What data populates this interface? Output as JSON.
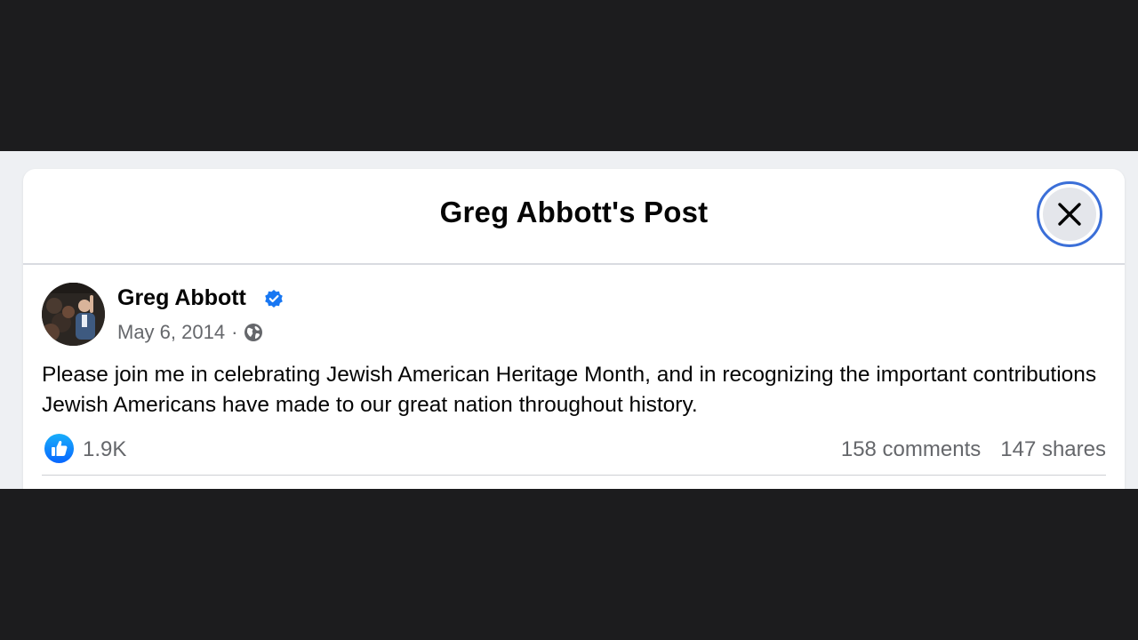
{
  "dialog": {
    "title": "Greg Abbott's Post",
    "close_icon": "close-icon"
  },
  "post": {
    "author": "Greg Abbott",
    "verified_icon": "verified-badge-icon",
    "date": "May 6, 2014",
    "separator": "·",
    "audience_icon": "globe-icon",
    "text": "Please join me in celebrating Jewish American Heritage Month, and in recognizing the important contributions Jewish Americans have made to our great nation throughout history.",
    "stats": {
      "reaction_icon": "like-icon",
      "reactions": "1.9K",
      "comments": "158 comments",
      "shares": "147 shares"
    }
  },
  "colors": {
    "brand_blue": "#1877f2",
    "focus_ring": "#3b6fd8",
    "secondary_text": "#65676b",
    "primary_text": "#050505",
    "backdrop": "#1c1c1e"
  }
}
